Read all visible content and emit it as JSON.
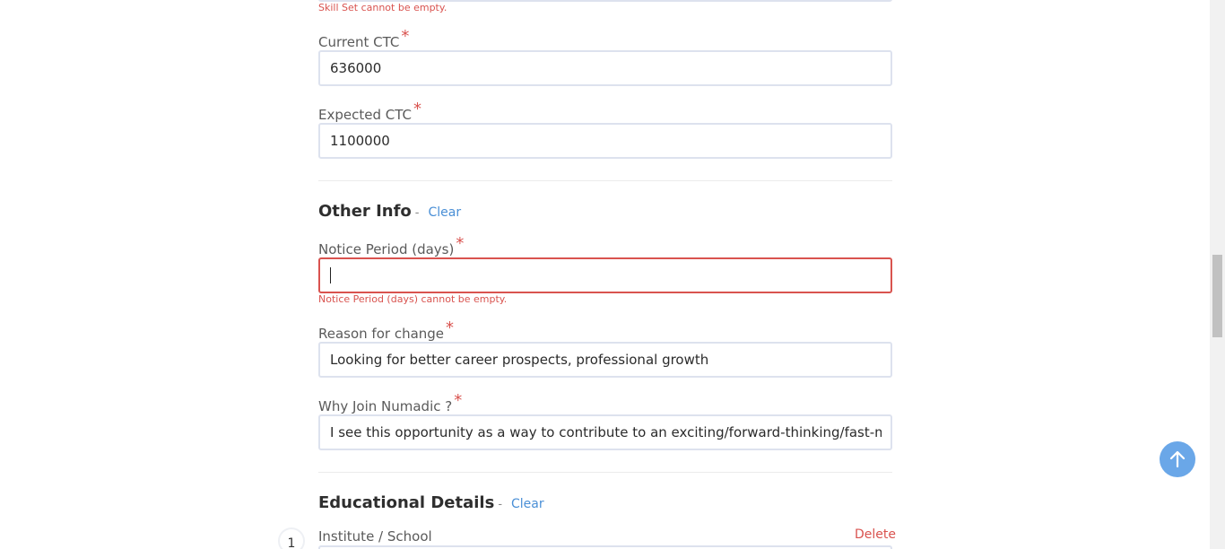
{
  "skill_set": {
    "error": "Skill Set cannot be empty."
  },
  "current_ctc": {
    "label": "Current CTC",
    "required_mark": "*",
    "value": "636000"
  },
  "expected_ctc": {
    "label": "Expected CTC",
    "required_mark": "*",
    "value": "1100000"
  },
  "other_info": {
    "title": "Other Info",
    "separator": "-",
    "clear_label": "Clear",
    "notice_period": {
      "label": "Notice Period (days)",
      "required_mark": "*",
      "value": "",
      "error": "Notice Period (days) cannot be empty."
    },
    "reason_for_change": {
      "label": "Reason for change",
      "required_mark": "*",
      "value": "Looking for better career prospects, professional growth"
    },
    "why_join": {
      "label": "Why Join Numadic ?",
      "required_mark": "*",
      "value": "I see this opportunity as a way to contribute to an exciting/forward-thinking/fast-moving comp"
    }
  },
  "educational_details": {
    "title": "Educational Details",
    "separator": "-",
    "clear_label": "Clear",
    "entry_number": "1",
    "institute_label": "Institute / School",
    "delete_label": "Delete"
  },
  "colors": {
    "error": "#d9534f",
    "link": "#4a8fd6",
    "scroll_top_button": "#6aa7e8"
  },
  "icons": {
    "scroll_top": "arrow-up-icon"
  }
}
